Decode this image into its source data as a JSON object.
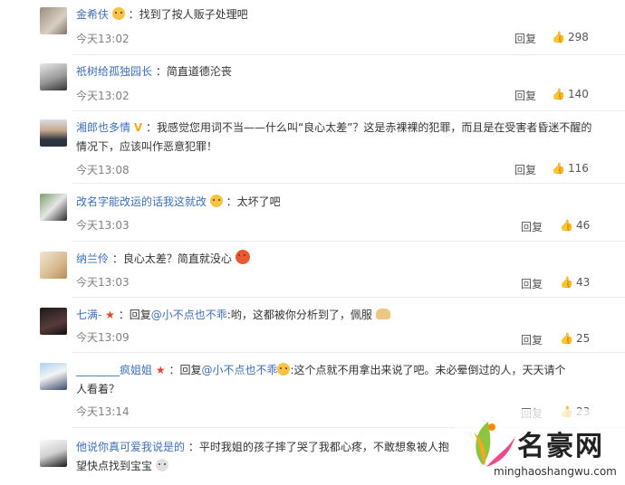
{
  "comments": [
    {
      "user": "金希伕",
      "text": "：找到了按人贩子处理吧",
      "time": "今天13:02",
      "reply": "回复",
      "likes": "298"
    },
    {
      "user": "祇树给孤独园长",
      "text": "：简直道德沦丧",
      "time": "今天13:02",
      "reply": "回复",
      "likes": "140"
    },
    {
      "user": "湘郎也多情",
      "text_line1": "：我感觉您用词不当——什么叫“良心太差”？这是赤裸裸的犯罪，而且是在受害者昏迷不醒的",
      "text_line2": "情况下，应该叫作恶意犯罪！",
      "time": "今天13:08",
      "reply": "回复",
      "likes": "116"
    },
    {
      "user": "改名字能改运的话我这就改",
      "text": "：太坏了吧",
      "time": "今天13:03",
      "reply": "回复",
      "likes": "46"
    },
    {
      "user": "纳兰伶",
      "text": "：良心太差？简直就没心",
      "time": "今天13:03",
      "reply": "回复",
      "likes": "43"
    },
    {
      "user": "七满-",
      "prefix": "：回复",
      "at": "@小不点也不乖",
      "text": ":哟，这都被你分析到了，佩服",
      "time": "今天13:09",
      "reply": "回复",
      "likes": "25"
    },
    {
      "user": "________疯姐姐",
      "prefix": "：回复",
      "at": "@小不点也不乖",
      "text_line1": ":这个点就不用拿出来说了吧。未必晕倒过的人，天天请个",
      "text_line2": "人看着？",
      "time": "今天13:14",
      "reply": "回复",
      "likes": "23"
    },
    {
      "user": "他说你真可爱我说是的",
      "text_line1": "：平时我姐的孩子摔了哭了我都心疼，不敢想象被人抱",
      "text_line2": "望快点找到宝宝"
    }
  ],
  "watermark": {
    "brand": "名豪网",
    "url": "minghaoshangwu.com"
  }
}
